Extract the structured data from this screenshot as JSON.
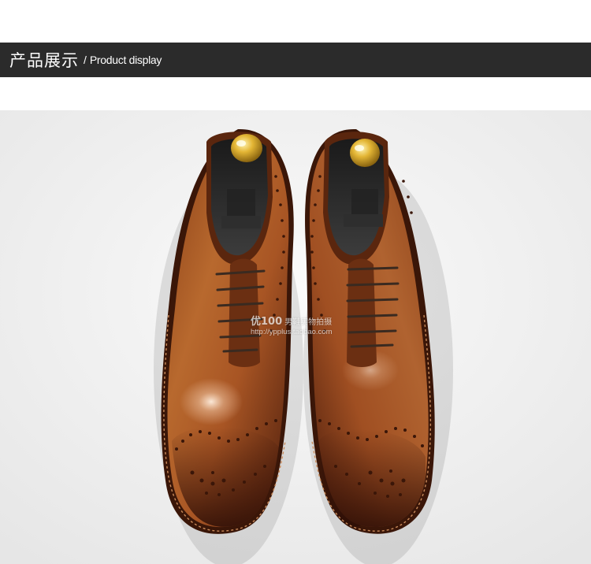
{
  "header": {
    "title_cn": "产品展示",
    "separator": "/",
    "title_en": "Product display",
    "background_color": "#2b2b2b",
    "text_color": "#ffffff"
  },
  "photo": {
    "subject": "pair of brown leather brogue oxford shoes with gold shoe trees, top view",
    "watermark": {
      "brand": "优100",
      "tagline": "男鞋实物拍摄",
      "url": "http://ypplus.taobao.com"
    },
    "colors": {
      "leather_light": "#b0622a",
      "leather_dark": "#4a1c0c",
      "background": "#f4f4f4",
      "shoe_tree_gold": "#d9a92a"
    }
  }
}
